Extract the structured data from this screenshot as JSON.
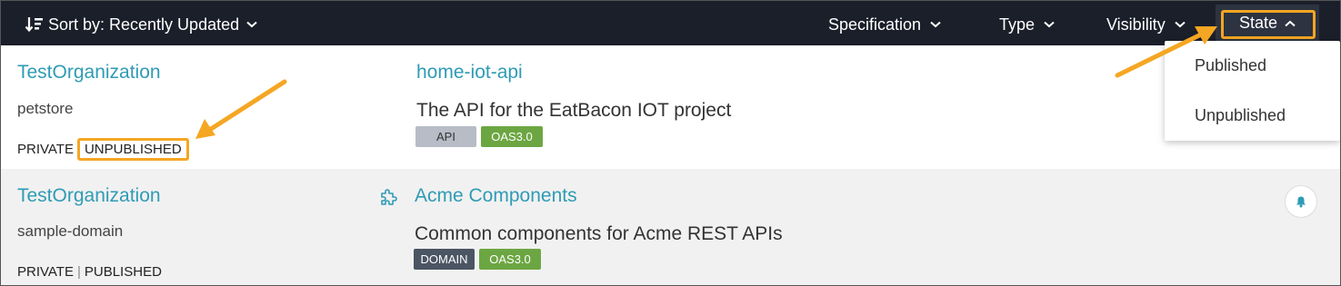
{
  "toolbar": {
    "sort_label": "Sort by: Recently Updated",
    "filters": {
      "specification": "Specification",
      "type": "Type",
      "visibility": "Visibility",
      "state": "State"
    }
  },
  "state_dropdown": {
    "options": [
      "Published",
      "Unpublished"
    ]
  },
  "results": [
    {
      "organization": "TestOrganization",
      "owner": "petstore",
      "visibility": "PRIVATE",
      "state": "UNPUBLISHED",
      "name": "home-iot-api",
      "description": "The API for the EatBacon IOT project",
      "badges": [
        "API",
        "OAS3.0"
      ]
    },
    {
      "organization": "TestOrganization",
      "owner": "sample-domain",
      "visibility": "PRIVATE",
      "separator": "|",
      "state": "PUBLISHED",
      "name": "Acme Components",
      "description": "Common components for Acme REST APIs",
      "badges": [
        "DOMAIN",
        "OAS3.0"
      ]
    }
  ],
  "colors": {
    "topbar": "#1b1f2a",
    "link": "#2f9bb5",
    "highlight": "#f5a623",
    "badge_oas": "#6ca642",
    "badge_domain": "#4b5563",
    "badge_api": "#b7bcc6"
  },
  "icons": {
    "sort": "sort-icon",
    "chevron": "chevron-down-icon",
    "chevron_up": "chevron-up-icon",
    "domain": "puzzle-icon",
    "notify": "bell-icon"
  }
}
